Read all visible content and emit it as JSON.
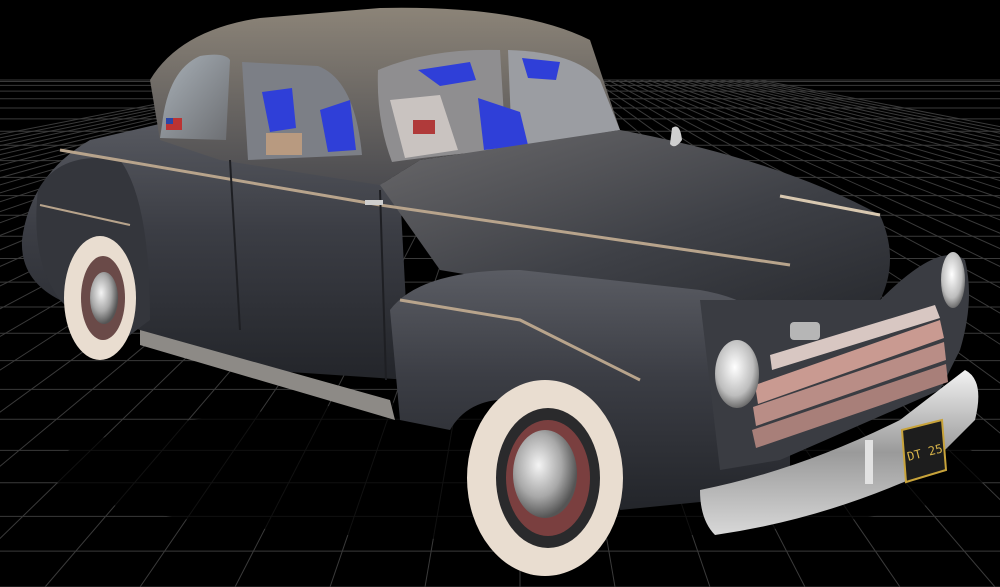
{
  "scene": {
    "subject": "vintage-coupe-3d-scan",
    "background_color": "#000000",
    "grid_color": "#3a3a3a",
    "body_color": "#3b3d44",
    "whitewall_color": "#e9ddd0",
    "chrome_color": "#cfcfcf",
    "grille_color": "#b98d86",
    "scan_gap_color": "#2f3fd8"
  },
  "plate": {
    "text": "DT 25"
  }
}
